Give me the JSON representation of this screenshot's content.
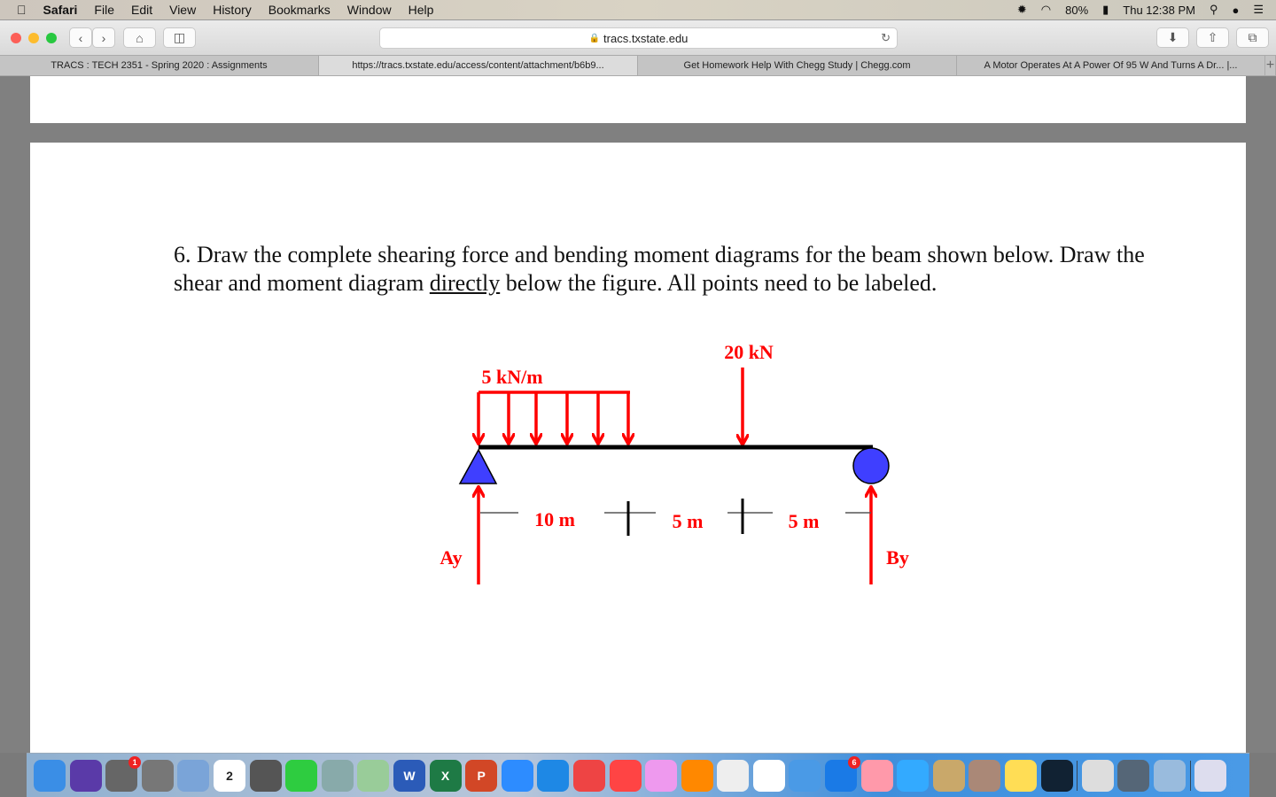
{
  "menubar": {
    "app": "Safari",
    "items": [
      "File",
      "Edit",
      "View",
      "History",
      "Bookmarks",
      "Window",
      "Help"
    ],
    "battery": "80%",
    "clock": "Thu 12:38 PM"
  },
  "toolbar": {
    "url": "tracs.txstate.edu"
  },
  "tabs": [
    {
      "label": "TRACS : TECH 2351 - Spring 2020 : Assignments",
      "active": false
    },
    {
      "label": "https://tracs.txstate.edu/access/content/attachment/b6b9...",
      "active": true
    },
    {
      "label": "Get Homework Help With Chegg Study | Chegg.com",
      "active": false
    },
    {
      "label": "A Motor Operates At A Power Of 95 W And Turns A Dr... |...",
      "active": false
    }
  ],
  "document": {
    "question_pre": "6. Draw the complete shearing force and bending moment diagrams for the beam shown below. Draw the shear and moment diagram ",
    "question_underlined": "directly",
    "question_post": " below the figure. All points need to be labeled.",
    "diagram": {
      "distributed_load": "5 kN/m",
      "point_load": "20 kN",
      "dim1": "10 m",
      "dim2": "5 m",
      "dim3": "5 m",
      "reaction_a": "Ay",
      "reaction_b": "By",
      "load_color": "#ff0000",
      "support_color": "#3f3fff"
    }
  },
  "dock": [
    {
      "name": "finder",
      "color": "#3a8ee6"
    },
    {
      "name": "siri",
      "color": "#5a3aa8"
    },
    {
      "name": "system-preferences",
      "color": "#666",
      "badge": "1"
    },
    {
      "name": "launchpad",
      "color": "#777"
    },
    {
      "name": "mail",
      "color": "#7aa4d8"
    },
    {
      "name": "calendar",
      "color": "#fff",
      "text": "2"
    },
    {
      "name": "calculator",
      "color": "#555"
    },
    {
      "name": "facetime",
      "color": "#2ecc40"
    },
    {
      "name": "preview",
      "color": "#8aa"
    },
    {
      "name": "maps",
      "color": "#9c9"
    },
    {
      "name": "word",
      "color": "#2b5bb8",
      "text": "W"
    },
    {
      "name": "excel",
      "color": "#1e7a45",
      "text": "X"
    },
    {
      "name": "powerpoint",
      "color": "#d24726",
      "text": "P"
    },
    {
      "name": "zoom",
      "color": "#2d8cff"
    },
    {
      "name": "safari",
      "color": "#1e88e5"
    },
    {
      "name": "chrome",
      "color": "#e44"
    },
    {
      "name": "news",
      "color": "#f44"
    },
    {
      "name": "itunes",
      "color": "#e9e"
    },
    {
      "name": "books",
      "color": "#f80"
    },
    {
      "name": "photos",
      "color": "#eee"
    },
    {
      "name": "numbers",
      "color": "#fff"
    },
    {
      "name": "keynote",
      "color": "#4a9ae6"
    },
    {
      "name": "app-store",
      "color": "#1a7ae6",
      "badge": "6"
    },
    {
      "name": "pages",
      "color": "#f9a"
    },
    {
      "name": "messages",
      "color": "#3af"
    },
    {
      "name": "solitaire",
      "color": "#c9a86a"
    },
    {
      "name": "chess",
      "color": "#a87"
    },
    {
      "name": "notes",
      "color": "#fd5"
    },
    {
      "name": "kindle",
      "color": "#123"
    },
    {
      "name": "sep"
    },
    {
      "name": "downloads",
      "color": "#ddd"
    },
    {
      "name": "documents",
      "color": "#567"
    },
    {
      "name": "migration",
      "color": "#9bd"
    },
    {
      "name": "sep"
    },
    {
      "name": "trash",
      "color": "#dde"
    }
  ]
}
